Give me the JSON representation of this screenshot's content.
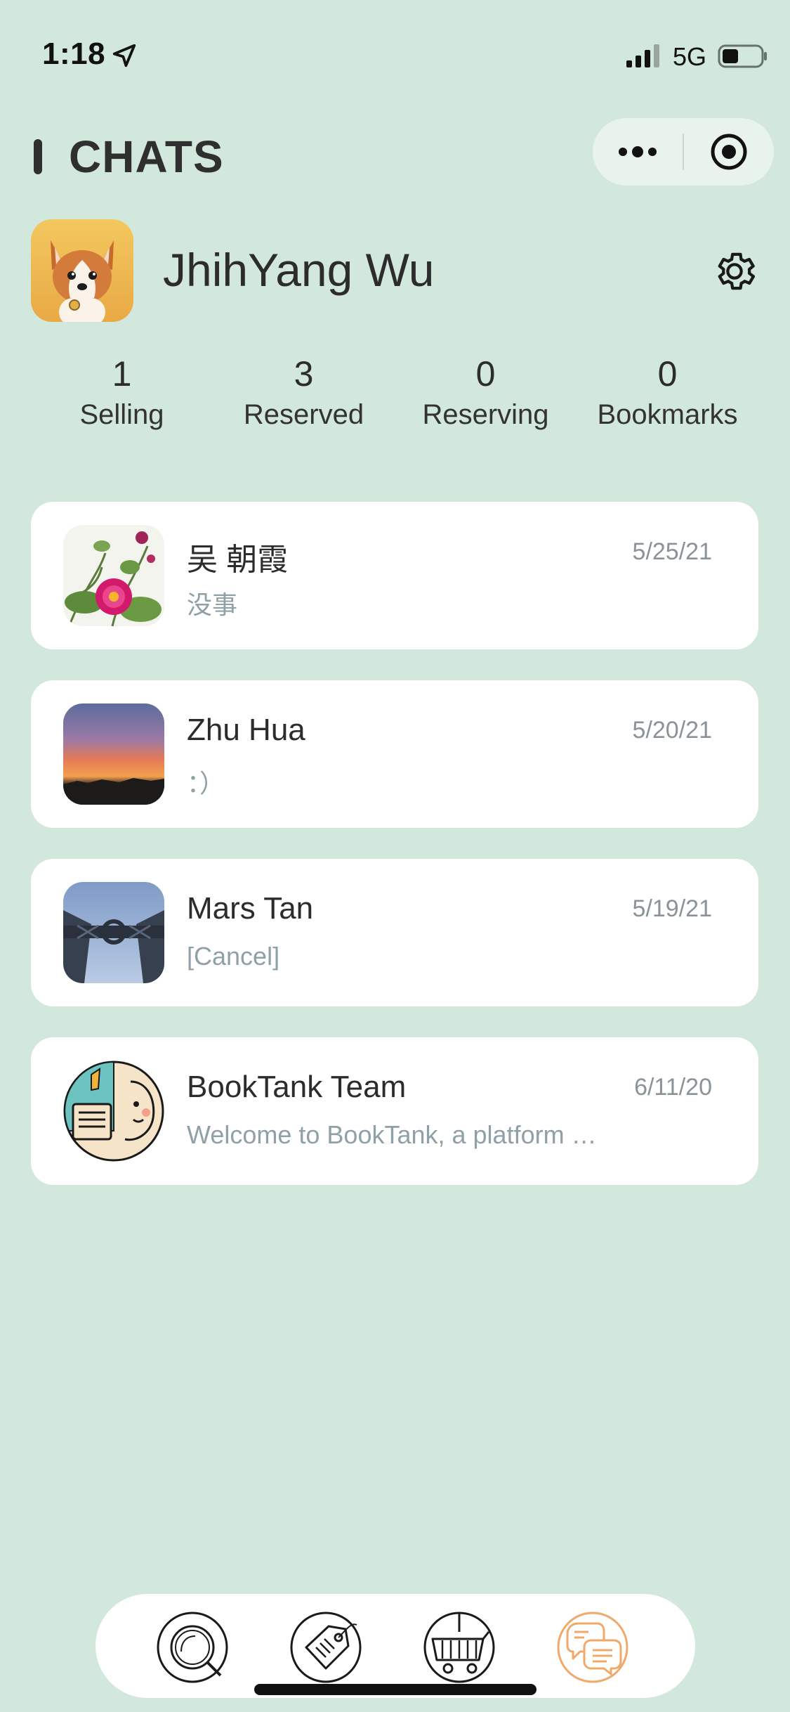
{
  "status_bar": {
    "time": "1:18",
    "network": "5G",
    "icons": [
      "location-arrow-icon",
      "signal-icon",
      "battery-icon"
    ]
  },
  "header": {
    "title": "CHATS",
    "capsule_icons": [
      "more-dots-icon",
      "close-target-icon"
    ]
  },
  "profile": {
    "name": "JhihYang Wu",
    "avatar": "corgi-avatar",
    "settings_icon": "gear-icon"
  },
  "stats": [
    {
      "value": "1",
      "label": "Selling"
    },
    {
      "value": "3",
      "label": "Reserved"
    },
    {
      "value": "0",
      "label": "Reserving"
    },
    {
      "value": "0",
      "label": "Bookmarks"
    }
  ],
  "chats": [
    {
      "name": "吴 朝霞",
      "date": "5/25/21",
      "preview": "没事",
      "thumb": "pink-flower-photo"
    },
    {
      "name": "Zhu Hua",
      "date": "5/20/21",
      "preview": "：）",
      "thumb": "sunset-photo"
    },
    {
      "name": "Mars Tan",
      "date": "5/19/21",
      "preview": "[Cancel]",
      "thumb": "bridge-sky-photo"
    },
    {
      "name": "BookTank Team",
      "date": "6/11/20",
      "preview": "Welcome to BookTank, a platform …",
      "thumb": "booktank-logo"
    }
  ],
  "tab_bar": {
    "tabs": [
      "search-tab-icon",
      "sell-tag-tab-icon",
      "cart-tab-icon",
      "chats-tab-icon"
    ],
    "active_index": 3,
    "active_color": "#f0a96b",
    "inactive_color": "#1a1a1a"
  },
  "colors": {
    "background": "#d2e8dc",
    "card": "#ffffff",
    "muted_text": "#8fa0a6"
  }
}
